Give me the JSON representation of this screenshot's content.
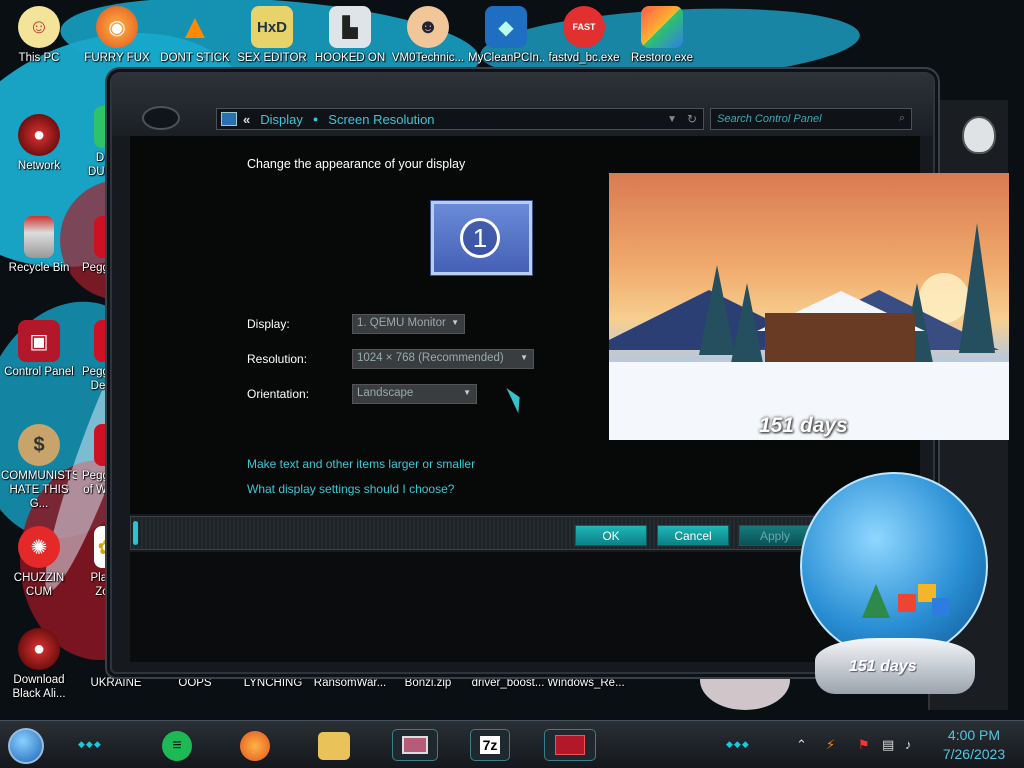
{
  "desktop_icons": [
    {
      "label": "This PC",
      "icon": "cartoon-face-icon"
    },
    {
      "label": "FURRY FUX",
      "icon": "firefox-icon"
    },
    {
      "label": "DONT STICK",
      "icon": "vlc-cone-icon"
    },
    {
      "label": "SEX EDITOR",
      "icon": "hex-editor-icon"
    },
    {
      "label": "HOOKED ON",
      "icon": "maze-icon"
    },
    {
      "label": "VM0Technic...",
      "icon": "doctor-icon"
    },
    {
      "label": "MyCleanPCIn...",
      "icon": "blue-shield-icon"
    },
    {
      "label": "fastvd_bc.exe",
      "icon": "fast-video-downloader-icon"
    },
    {
      "label": "Restoro.exe",
      "icon": "restoro-icon"
    },
    {
      "label": "Network",
      "icon": "network-orb-icon"
    },
    {
      "label": "Recycle Bin",
      "icon": "recycle-bin-icon"
    },
    {
      "label": "Control Panel",
      "icon": "control-panel-icon"
    },
    {
      "label": "COMMUNISTS HATE THIS G...",
      "icon": "money-bag-icon"
    },
    {
      "label": "CHUZZIN CUM",
      "icon": "chuzzle-icon"
    },
    {
      "label": "Download Black Ali...",
      "icon": "download-orb-icon"
    },
    {
      "label": "UKRAINE",
      "icon": "ukraine-icon"
    },
    {
      "label": "OOPS",
      "icon": "oops-icon"
    },
    {
      "label": "LYNCHING",
      "icon": "lynching-icon"
    },
    {
      "label": "RansomWar...",
      "icon": "ransomware-icon"
    },
    {
      "label": "Bonzi.zip",
      "icon": "zip-icon"
    },
    {
      "label": "driver_boost...",
      "icon": "driver-booster-icon"
    },
    {
      "label": "Windows_Re...",
      "icon": "windows-repair-icon"
    },
    {
      "label": "D DUM",
      "icon": "partial-icon"
    },
    {
      "label": "Peggle",
      "icon": "peggle-icon"
    },
    {
      "label": "Peggle De",
      "icon": "peggle-deluxe-icon"
    },
    {
      "label": "Peggle of Wa",
      "icon": "peggle-nights-icon"
    },
    {
      "label": "Plan Zo",
      "icon": "plants-zombies-icon"
    }
  ],
  "window": {
    "breadcrumb_chevron": "«",
    "breadcrumb": [
      "Display",
      "Screen Resolution"
    ],
    "search_placeholder": "Search Control Panel",
    "heading": "Change the appearance of your display",
    "monitor_number": "1",
    "fields": {
      "display_label": "Display:",
      "display_value": "1. QEMU Monitor",
      "resolution_label": "Resolution:",
      "resolution_value": "1024 × 768 (Recommended)",
      "orientation_label": "Orientation:",
      "orientation_value": "Landscape"
    },
    "links": [
      "Make text and other items larger or smaller",
      "What display settings should I choose?"
    ],
    "buttons": {
      "ok": "OK",
      "cancel": "Cancel",
      "apply": "Apply"
    }
  },
  "wallpaper_widget": {
    "countdown_text": "151 days"
  },
  "snow_globe": {
    "countdown_text": "151 days"
  },
  "taskbar": {
    "pinned": [
      "spotify-icon",
      "firefox-icon",
      "file-explorer-icon",
      "monitor-app-icon",
      "7zip-icon",
      "alienware-app-icon"
    ],
    "seven_zip_label": "7z",
    "clock_time": "4:00 PM",
    "clock_date": "7/26/2023"
  },
  "colors": {
    "accent": "#38c8d6",
    "button": "#1a9fa4",
    "window_bg": "#070909"
  }
}
